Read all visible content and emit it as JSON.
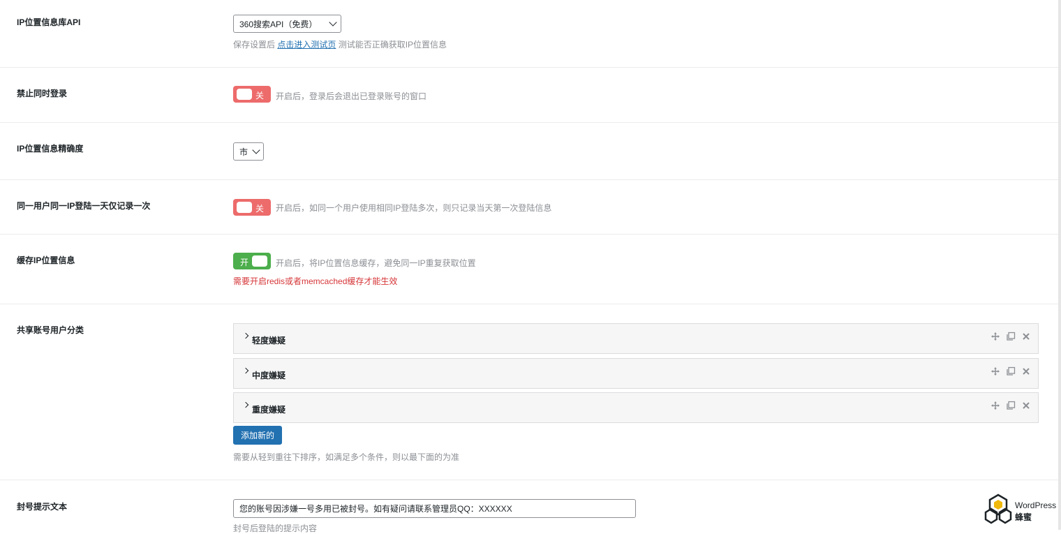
{
  "settings": {
    "ip_api": {
      "label": "IP位置信息库API",
      "selected": "360搜索API（免费）",
      "desc_prefix": "保存设置后 ",
      "desc_link": "点击进入测试页",
      "desc_suffix": " 测试能否正确获取IP位置信息"
    },
    "no_concurrent_login": {
      "label": "禁止同时登录",
      "toggle": "关",
      "desc": "开启后，登录后会退出已登录账号的窗口"
    },
    "ip_precision": {
      "label": "IP位置信息精确度",
      "selected": "市"
    },
    "once_per_day": {
      "label": "同一用户同一IP登陆一天仅记录一次",
      "toggle": "关",
      "desc": "开启后，如同一个用户使用相同IP登陆多次，则只记录当天第一次登陆信息"
    },
    "cache_ip": {
      "label": "缓存IP位置信息",
      "toggle": "开",
      "desc": "开启后，将IP位置信息缓存，避免同一IP重复获取位置",
      "warning": "需要开启redis或者memcached缓存才能生效"
    },
    "shared_account": {
      "label": "共享账号用户分类",
      "groups": [
        "轻度嫌疑",
        "中度嫌疑",
        "重度嫌疑"
      ],
      "add_button": "添加新的",
      "desc": "需要从轻到重往下排序，如满足多个条件，则以最下面的为准"
    },
    "ban_text": {
      "label": "封号提示文本",
      "value": "您的账号因涉嫌一号多用已被封号。如有疑问请联系管理员QQ：XXXXXX",
      "desc": "封号后登陆的提示内容"
    }
  },
  "logo": {
    "line1": "WordPress",
    "line2": "蜂蜜"
  },
  "colors": {
    "toggle_off": "#ed6b6b",
    "toggle_on": "#4cae4c",
    "primary": "#2271b1",
    "warning": "#d63638"
  }
}
